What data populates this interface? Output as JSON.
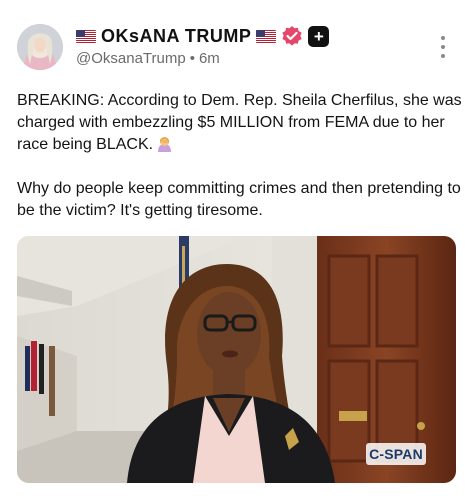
{
  "post": {
    "author": {
      "display_name": "OKsANA TRUMP",
      "handle": "@OksanaTrump",
      "time_ago": "6m",
      "flag_icon": "us-flag-icon",
      "verified_icon": "verified-badge-icon",
      "plus_badge": "+"
    },
    "text": {
      "paragraph_1": "BREAKING: According to Dem. Rep. Sheila Cherfilus, she was charged with embezzling $5 MILLION from FEMA due to her race being BLACK.",
      "paragraph_1_emoji": "woman-facepalming-emoji",
      "paragraph_2": "Why do people keep committing crimes and then pretending to be the victim? It's getting tiresome."
    },
    "media": {
      "watermark": "C-SPAN",
      "colors": {
        "wall": "#e9e6df",
        "door": "#7a3a1f",
        "jacket": "#1b1b1e",
        "blouse": "#f2d6cf"
      }
    },
    "menu_icon": "more-vertical-icon"
  }
}
